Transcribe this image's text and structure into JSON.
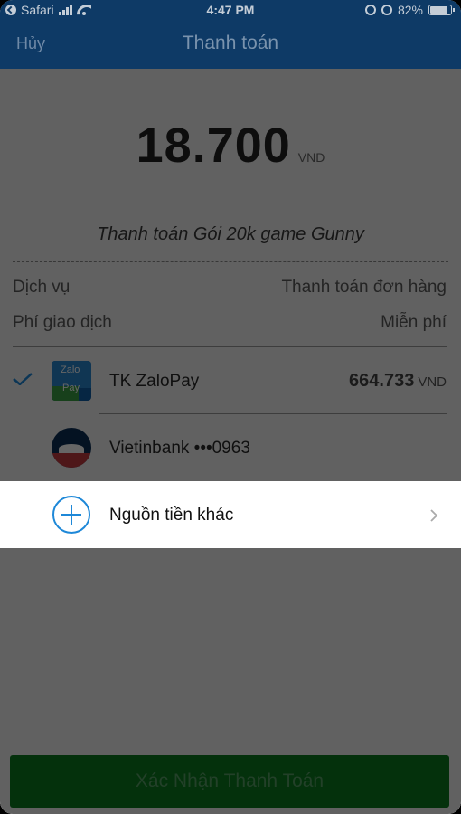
{
  "status_bar": {
    "app": "Safari",
    "time": "4:47 PM",
    "battery": "82%"
  },
  "nav": {
    "cancel_label": "Hủy",
    "title": "Thanh toán"
  },
  "payment": {
    "amount": "18.700",
    "currency": "VND",
    "description": "Thanh toán Gói 20k game Gunny"
  },
  "details": [
    {
      "label": "Dịch vụ",
      "value": "Thanh toán đơn hàng"
    },
    {
      "label": "Phí giao dịch",
      "value": "Miễn phí"
    }
  ],
  "sources": {
    "zalopay": {
      "name": "TK ZaloPay",
      "balance": "664.733",
      "currency": "VND",
      "logo_line1": "Zalo",
      "logo_line2": "Pay",
      "selected": true
    },
    "vietinbank": {
      "name": "Vietinbank •••0963",
      "selected": false
    },
    "other": {
      "label": "Nguồn tiền khác"
    }
  },
  "confirm_label": "Xác Nhận Thanh Toán",
  "colors": {
    "nav_bg": "#0e3a66",
    "confirm_bg": "#0b7a1f",
    "accent_blue": "#1e88d8"
  }
}
